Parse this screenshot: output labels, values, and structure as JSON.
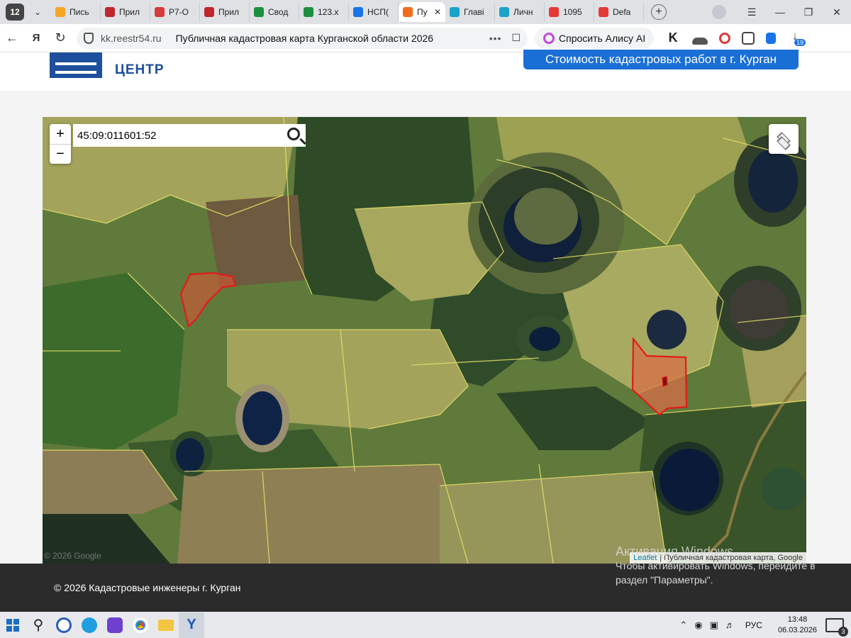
{
  "browser": {
    "tab_count": "12",
    "tabs": [
      {
        "label": "Пись",
        "color": "#f5a623"
      },
      {
        "label": "Прил",
        "color": "#c0262d"
      },
      {
        "label": "Р7-О",
        "color": "#d43b3b"
      },
      {
        "label": "Прил",
        "color": "#c0262d"
      },
      {
        "label": "Свод",
        "color": "#1e8e3e"
      },
      {
        "label": "123.x",
        "color": "#1e8e3e"
      },
      {
        "label": "НСП(",
        "color": "#1a73e8"
      },
      {
        "label": "Пу",
        "color": "#f26b1d",
        "active": true
      },
      {
        "label": "Главі",
        "color": "#1aa3c8"
      },
      {
        "label": "Личн",
        "color": "#1aa3c8"
      },
      {
        "label": "1095",
        "color": "#e53935"
      },
      {
        "label": "Defa",
        "color": "#e53935"
      }
    ],
    "url_domain": "kk.reestr54.ru",
    "page_title": "Публичная кадастровая карта Курганской области 2026",
    "alice_label": "Спросить Алису AI",
    "ext_badge": "19"
  },
  "site": {
    "logo_text": "ЦЕНТР",
    "cta_label": "Стоимость кадастровых работ в г. Курган"
  },
  "map": {
    "zoom_in": "+",
    "zoom_out": "−",
    "search_value": "45:09:011601:52",
    "attribution_link": "Leaflet",
    "attribution_rest": "| Публичная кадастровая карта, Google",
    "google_watermark": "© 2026 Google"
  },
  "footer": {
    "copyright": "© 2026 Кадастровые инженеры г. Курган"
  },
  "windows_activation": {
    "line1": "Активация Windows",
    "line2": "Чтобы активировать Windows, перейдите в",
    "line3": "раздел \"Параметры\"."
  },
  "taskbar": {
    "language": "РУС",
    "time": "13:48",
    "date": "06.03.2026",
    "notifications": "3"
  }
}
